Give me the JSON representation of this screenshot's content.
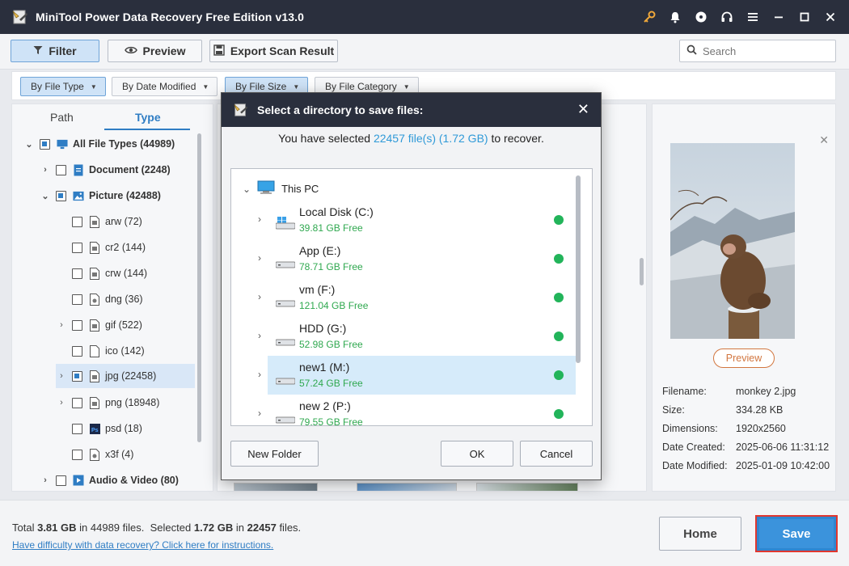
{
  "app": {
    "title": "MiniTool Power Data Recovery Free Edition v13.0"
  },
  "toolbar": {
    "filter_label": "Filter",
    "preview_label": "Preview",
    "export_label": "Export Scan Result",
    "search_placeholder": "Search"
  },
  "filters": {
    "by_file_type": "By File Type",
    "by_date_modified": "By Date Modified",
    "by_file_size": "By File Size",
    "by_file_category": "By File Category"
  },
  "left": {
    "tabs": {
      "path": "Path",
      "type": "Type"
    },
    "tree": [
      {
        "label": "All File Types (44989)"
      },
      {
        "label": "Document (2248)"
      },
      {
        "label": "Picture (42488)"
      },
      {
        "label": "arw (72)"
      },
      {
        "label": "cr2 (144)"
      },
      {
        "label": "crw (144)"
      },
      {
        "label": "dng (36)"
      },
      {
        "label": "gif (522)"
      },
      {
        "label": "ico (142)"
      },
      {
        "label": "jpg (22458)"
      },
      {
        "label": "png (18948)"
      },
      {
        "label": "psd (18)"
      },
      {
        "label": "x3f (4)"
      },
      {
        "label": "Audio & Video (80)"
      }
    ]
  },
  "preview": {
    "button_label": "Preview",
    "info": [
      {
        "key": "Filename:",
        "value": "monkey 2.jpg"
      },
      {
        "key": "Size:",
        "value": "334.28 KB"
      },
      {
        "key": "Dimensions:",
        "value": "1920x2560"
      },
      {
        "key": "Date Created:",
        "value": "2025-06-06 11:31:12"
      },
      {
        "key": "Date Modified:",
        "value": "2025-01-09 10:42:00"
      }
    ]
  },
  "bottom": {
    "total_prefix": "Total",
    "total_size": "3.81 GB",
    "in_1": "in",
    "total_files": "44989",
    "files_1": "files.",
    "selected_prefix": "Selected",
    "selected_size": "1.72 GB",
    "in_2": "in",
    "selected_files": "22457",
    "files_2": "files.",
    "help_link": "Have difficulty with data recovery? Click here for instructions.",
    "home_label": "Home",
    "save_label": "Save"
  },
  "dialog": {
    "title": "Select a directory to save files:",
    "msg_before": "You have selected",
    "msg_highlight": "22457 file(s) (1.72 GB)",
    "msg_after": "to recover.",
    "this_pc": "This PC",
    "drives": [
      {
        "name": "Local Disk (C:)",
        "free": "39.81 GB Free"
      },
      {
        "name": "App (E:)",
        "free": "78.71 GB Free"
      },
      {
        "name": "vm (F:)",
        "free": "121.04 GB Free"
      },
      {
        "name": "HDD (G:)",
        "free": "52.98 GB Free"
      },
      {
        "name": "new1 (M:)",
        "free": "57.24 GB Free"
      },
      {
        "name": "new 2 (P:)",
        "free": "79.55 GB Free"
      }
    ],
    "new_folder_label": "New Folder",
    "ok_label": "OK",
    "cancel_label": "Cancel"
  },
  "colors": {
    "titlebar": "#2a2f3d",
    "accent_blue": "#2f7dc4",
    "free_green": "#2fa84f",
    "status_dot": "#22b45a",
    "save_border": "#e0372f"
  }
}
